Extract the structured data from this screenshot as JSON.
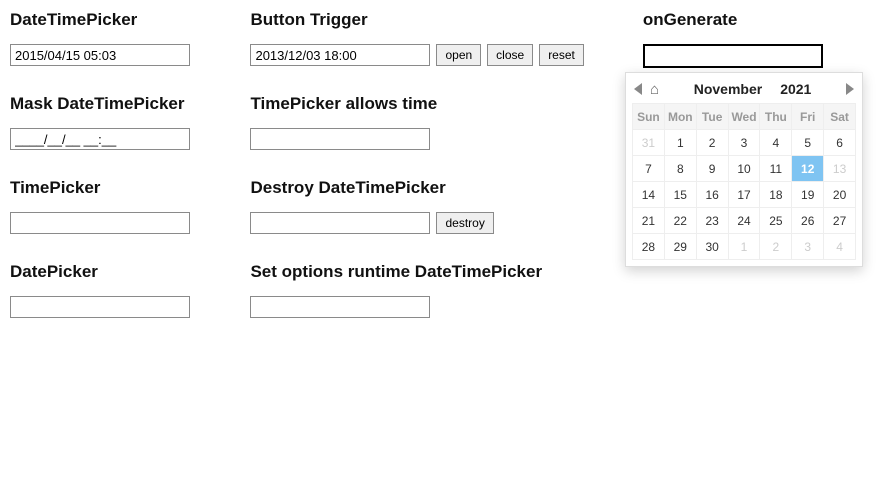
{
  "col1": {
    "datetimepicker": {
      "heading": "DateTimePicker",
      "value": "2015/04/15 05:03"
    },
    "mask": {
      "heading": "Mask DateTimePicker",
      "value": "____/__/__ __:__"
    },
    "timepicker": {
      "heading": "TimePicker",
      "value": ""
    },
    "datepicker": {
      "heading": "DatePicker",
      "value": ""
    }
  },
  "col2": {
    "button_trigger": {
      "heading": "Button Trigger",
      "value": "2013/12/03 18:00",
      "buttons": {
        "open": "open",
        "close": "close",
        "reset": "reset"
      }
    },
    "allows_time": {
      "heading": "TimePicker allows time",
      "value": ""
    },
    "destroy": {
      "heading": "Destroy DateTimePicker",
      "value": "",
      "button": "destroy"
    },
    "runtime": {
      "heading": "Set options runtime DateTimePicker",
      "value": ""
    }
  },
  "col3": {
    "ongenerate": {
      "heading": "onGenerate",
      "value": ""
    }
  },
  "calendar": {
    "month": "November",
    "year": "2021",
    "dow": [
      "Sun",
      "Mon",
      "Tue",
      "Wed",
      "Thu",
      "Fri",
      "Sat"
    ],
    "weeks": [
      [
        {
          "d": "31",
          "muted": true
        },
        {
          "d": "1"
        },
        {
          "d": "2"
        },
        {
          "d": "3"
        },
        {
          "d": "4"
        },
        {
          "d": "5"
        },
        {
          "d": "6"
        }
      ],
      [
        {
          "d": "7"
        },
        {
          "d": "8"
        },
        {
          "d": "9"
        },
        {
          "d": "10"
        },
        {
          "d": "11"
        },
        {
          "d": "12",
          "selected": true
        },
        {
          "d": "13",
          "muted": true
        }
      ],
      [
        {
          "d": "14"
        },
        {
          "d": "15"
        },
        {
          "d": "16"
        },
        {
          "d": "17"
        },
        {
          "d": "18"
        },
        {
          "d": "19"
        },
        {
          "d": "20"
        }
      ],
      [
        {
          "d": "21"
        },
        {
          "d": "22"
        },
        {
          "d": "23"
        },
        {
          "d": "24"
        },
        {
          "d": "25"
        },
        {
          "d": "26"
        },
        {
          "d": "27"
        }
      ],
      [
        {
          "d": "28"
        },
        {
          "d": "29"
        },
        {
          "d": "30"
        },
        {
          "d": "1",
          "muted": true
        },
        {
          "d": "2",
          "muted": true
        },
        {
          "d": "3",
          "muted": true
        },
        {
          "d": "4",
          "muted": true
        }
      ]
    ]
  }
}
